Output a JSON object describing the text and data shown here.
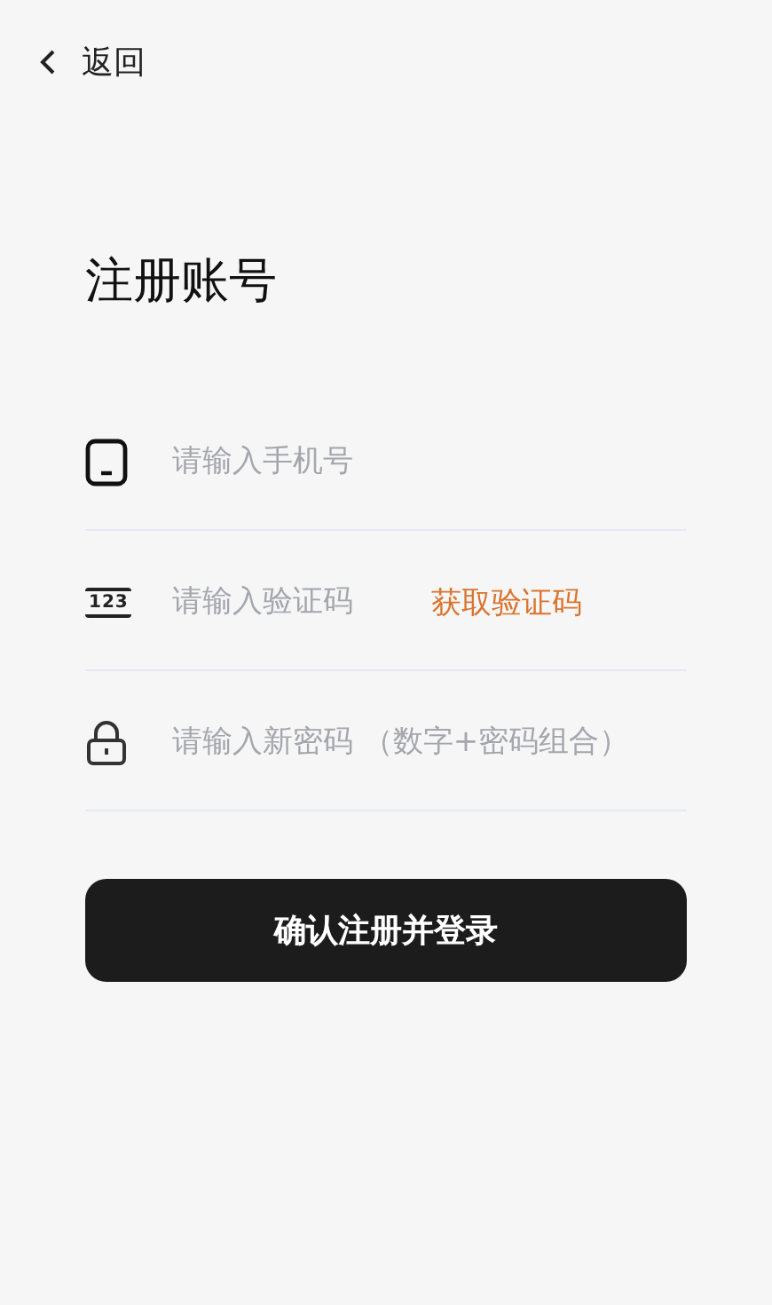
{
  "nav": {
    "back_label": "返回"
  },
  "title": "注册账号",
  "fields": [
    {
      "kind": "phone",
      "placeholder": "请输入手机号"
    },
    {
      "kind": "code",
      "placeholder": "请输入验证码",
      "icon_text": "123",
      "action": "获取验证码"
    },
    {
      "kind": "password",
      "placeholder": "请输入新密码 （数字+密码组合）"
    }
  ],
  "submit": "确认注册并登录"
}
